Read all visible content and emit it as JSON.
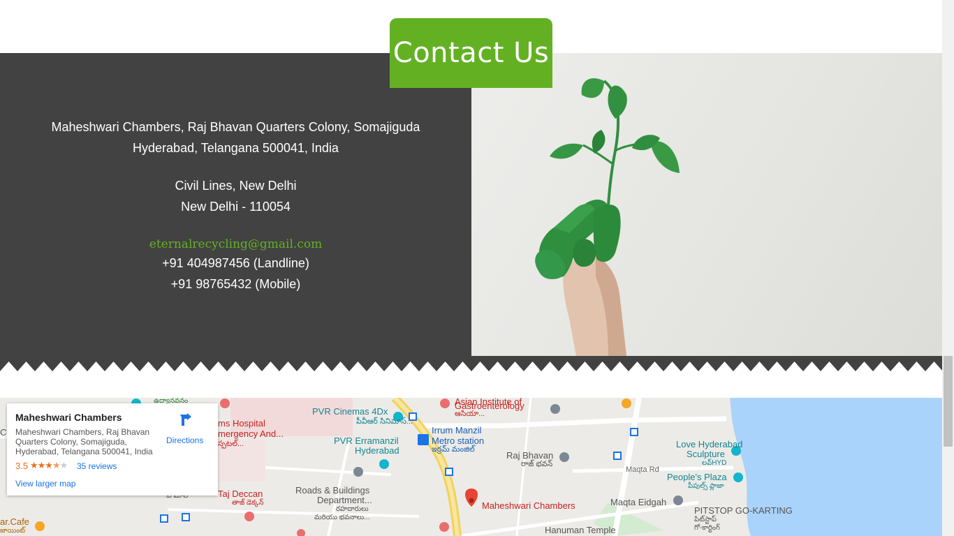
{
  "contact": {
    "title": "Contact Us",
    "address1_line1": "Maheshwari Chambers, Raj Bhavan Quarters Colony, Somajiguda",
    "address1_line2": "Hyderabad, Telangana 500041, India",
    "address2_line1": "Civil Lines, New Delhi",
    "address2_line2": "New Delhi - 110054",
    "email": "eternalrecycling@gmail.com",
    "phone_landline": "+91 404987456 (Landline)",
    "phone_mobile": "+91 98765432 (Mobile)"
  },
  "colors": {
    "accent": "#63b123",
    "dark_panel": "#424242",
    "water": "#a9d3fa"
  },
  "map": {
    "card": {
      "name": "Maheshwari Chambers",
      "address": "Maheshwari Chambers, Raj Bhavan Quarters Colony, Somajiguda, Hyderabad, Telangana 500041, India",
      "rating": "3.5",
      "stars": "★★★★★",
      "reviews": "35 reviews",
      "larger_map": "View larger map",
      "directions": "Directions"
    },
    "labels": {
      "pvr_cinemas": "PVR Cinemas 4Dx",
      "pvr_cinemas_te": "పీవీఆర్ సినిమాస్...",
      "gastro_1": "Asian Institute of",
      "gastro_2": "Gastroenterology",
      "gastro_te": "ఆసియా...",
      "hospital_1": "ms Hospital",
      "hospital_2": "mergency And...",
      "hospital_te": "స్పటల్...",
      "irrum_1": "Irrum Manzil",
      "irrum_2": "Metro station",
      "irrum_te": "ఇర్రమ్ మంజిల్",
      "pvr_erramanzil_1": "PVR Erramanzil",
      "pvr_erramanzil_2": "Hyderabad",
      "raj_bhavan": "Raj Bhavan",
      "raj_bhavan_te": "రాజ్ భవన్",
      "love_hyd_1": "Love Hyderabad",
      "love_hyd_2": "Sculpture",
      "love_hyd_te": "లవ్HYD",
      "maqta_rd": "Maqta Rd",
      "peoples_plaza": "People's Plaza",
      "peoples_plaza_te": "పీపుల్స్ ప్లాజా",
      "roads_1": "Roads & Buildings",
      "roads_2": "Department...",
      "roads_te_1": "రహదారులు",
      "roads_te_2": "మరియు భవనాలు...",
      "taj_deccan": "Taj Deccan",
      "taj_deccan_te": "తాజ్ డెక్కన్",
      "maheshwari_pin": "Maheshwari Chambers",
      "maqta_eidgah": "Maqta Eidgah",
      "pitstop": "PITSTOP GO-KARTING",
      "pitstop_te_1": "పిట్‌స్టాప్",
      "pitstop_te_2": "గో-కార్టింగ్",
      "hanuman": "Hanuman Temple",
      "udyanavanam": "ఉద్యానవనం",
      "bar_cafe": "ar.Cafe",
      "bar_cafe_te": "జాయింట్",
      "co": "Co",
      "bi_mall": "బి మాల్"
    }
  }
}
